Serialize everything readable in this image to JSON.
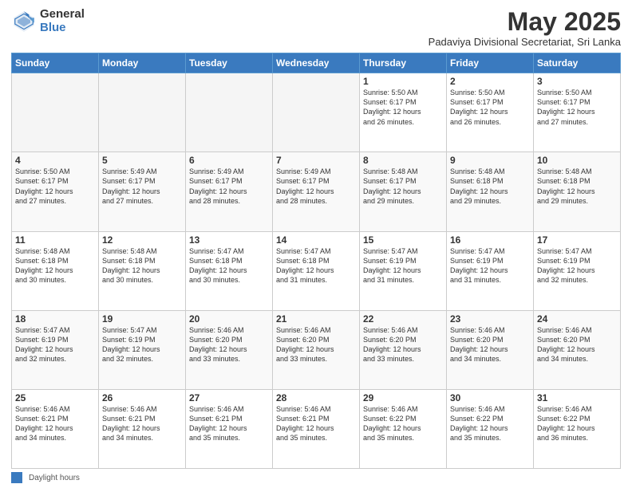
{
  "logo": {
    "general": "General",
    "blue": "Blue"
  },
  "title": "May 2025",
  "subtitle": "Padaviya Divisional Secretariat, Sri Lanka",
  "days_of_week": [
    "Sunday",
    "Monday",
    "Tuesday",
    "Wednesday",
    "Thursday",
    "Friday",
    "Saturday"
  ],
  "footer": {
    "legend_label": "Daylight hours"
  },
  "weeks": [
    [
      {
        "num": "",
        "info": ""
      },
      {
        "num": "",
        "info": ""
      },
      {
        "num": "",
        "info": ""
      },
      {
        "num": "",
        "info": ""
      },
      {
        "num": "1",
        "info": "Sunrise: 5:50 AM\nSunset: 6:17 PM\nDaylight: 12 hours\nand 26 minutes."
      },
      {
        "num": "2",
        "info": "Sunrise: 5:50 AM\nSunset: 6:17 PM\nDaylight: 12 hours\nand 26 minutes."
      },
      {
        "num": "3",
        "info": "Sunrise: 5:50 AM\nSunset: 6:17 PM\nDaylight: 12 hours\nand 27 minutes."
      }
    ],
    [
      {
        "num": "4",
        "info": "Sunrise: 5:50 AM\nSunset: 6:17 PM\nDaylight: 12 hours\nand 27 minutes."
      },
      {
        "num": "5",
        "info": "Sunrise: 5:49 AM\nSunset: 6:17 PM\nDaylight: 12 hours\nand 27 minutes."
      },
      {
        "num": "6",
        "info": "Sunrise: 5:49 AM\nSunset: 6:17 PM\nDaylight: 12 hours\nand 28 minutes."
      },
      {
        "num": "7",
        "info": "Sunrise: 5:49 AM\nSunset: 6:17 PM\nDaylight: 12 hours\nand 28 minutes."
      },
      {
        "num": "8",
        "info": "Sunrise: 5:48 AM\nSunset: 6:17 PM\nDaylight: 12 hours\nand 29 minutes."
      },
      {
        "num": "9",
        "info": "Sunrise: 5:48 AM\nSunset: 6:18 PM\nDaylight: 12 hours\nand 29 minutes."
      },
      {
        "num": "10",
        "info": "Sunrise: 5:48 AM\nSunset: 6:18 PM\nDaylight: 12 hours\nand 29 minutes."
      }
    ],
    [
      {
        "num": "11",
        "info": "Sunrise: 5:48 AM\nSunset: 6:18 PM\nDaylight: 12 hours\nand 30 minutes."
      },
      {
        "num": "12",
        "info": "Sunrise: 5:48 AM\nSunset: 6:18 PM\nDaylight: 12 hours\nand 30 minutes."
      },
      {
        "num": "13",
        "info": "Sunrise: 5:47 AM\nSunset: 6:18 PM\nDaylight: 12 hours\nand 30 minutes."
      },
      {
        "num": "14",
        "info": "Sunrise: 5:47 AM\nSunset: 6:18 PM\nDaylight: 12 hours\nand 31 minutes."
      },
      {
        "num": "15",
        "info": "Sunrise: 5:47 AM\nSunset: 6:19 PM\nDaylight: 12 hours\nand 31 minutes."
      },
      {
        "num": "16",
        "info": "Sunrise: 5:47 AM\nSunset: 6:19 PM\nDaylight: 12 hours\nand 31 minutes."
      },
      {
        "num": "17",
        "info": "Sunrise: 5:47 AM\nSunset: 6:19 PM\nDaylight: 12 hours\nand 32 minutes."
      }
    ],
    [
      {
        "num": "18",
        "info": "Sunrise: 5:47 AM\nSunset: 6:19 PM\nDaylight: 12 hours\nand 32 minutes."
      },
      {
        "num": "19",
        "info": "Sunrise: 5:47 AM\nSunset: 6:19 PM\nDaylight: 12 hours\nand 32 minutes."
      },
      {
        "num": "20",
        "info": "Sunrise: 5:46 AM\nSunset: 6:20 PM\nDaylight: 12 hours\nand 33 minutes."
      },
      {
        "num": "21",
        "info": "Sunrise: 5:46 AM\nSunset: 6:20 PM\nDaylight: 12 hours\nand 33 minutes."
      },
      {
        "num": "22",
        "info": "Sunrise: 5:46 AM\nSunset: 6:20 PM\nDaylight: 12 hours\nand 33 minutes."
      },
      {
        "num": "23",
        "info": "Sunrise: 5:46 AM\nSunset: 6:20 PM\nDaylight: 12 hours\nand 34 minutes."
      },
      {
        "num": "24",
        "info": "Sunrise: 5:46 AM\nSunset: 6:20 PM\nDaylight: 12 hours\nand 34 minutes."
      }
    ],
    [
      {
        "num": "25",
        "info": "Sunrise: 5:46 AM\nSunset: 6:21 PM\nDaylight: 12 hours\nand 34 minutes."
      },
      {
        "num": "26",
        "info": "Sunrise: 5:46 AM\nSunset: 6:21 PM\nDaylight: 12 hours\nand 34 minutes."
      },
      {
        "num": "27",
        "info": "Sunrise: 5:46 AM\nSunset: 6:21 PM\nDaylight: 12 hours\nand 35 minutes."
      },
      {
        "num": "28",
        "info": "Sunrise: 5:46 AM\nSunset: 6:21 PM\nDaylight: 12 hours\nand 35 minutes."
      },
      {
        "num": "29",
        "info": "Sunrise: 5:46 AM\nSunset: 6:22 PM\nDaylight: 12 hours\nand 35 minutes."
      },
      {
        "num": "30",
        "info": "Sunrise: 5:46 AM\nSunset: 6:22 PM\nDaylight: 12 hours\nand 35 minutes."
      },
      {
        "num": "31",
        "info": "Sunrise: 5:46 AM\nSunset: 6:22 PM\nDaylight: 12 hours\nand 36 minutes."
      }
    ]
  ]
}
